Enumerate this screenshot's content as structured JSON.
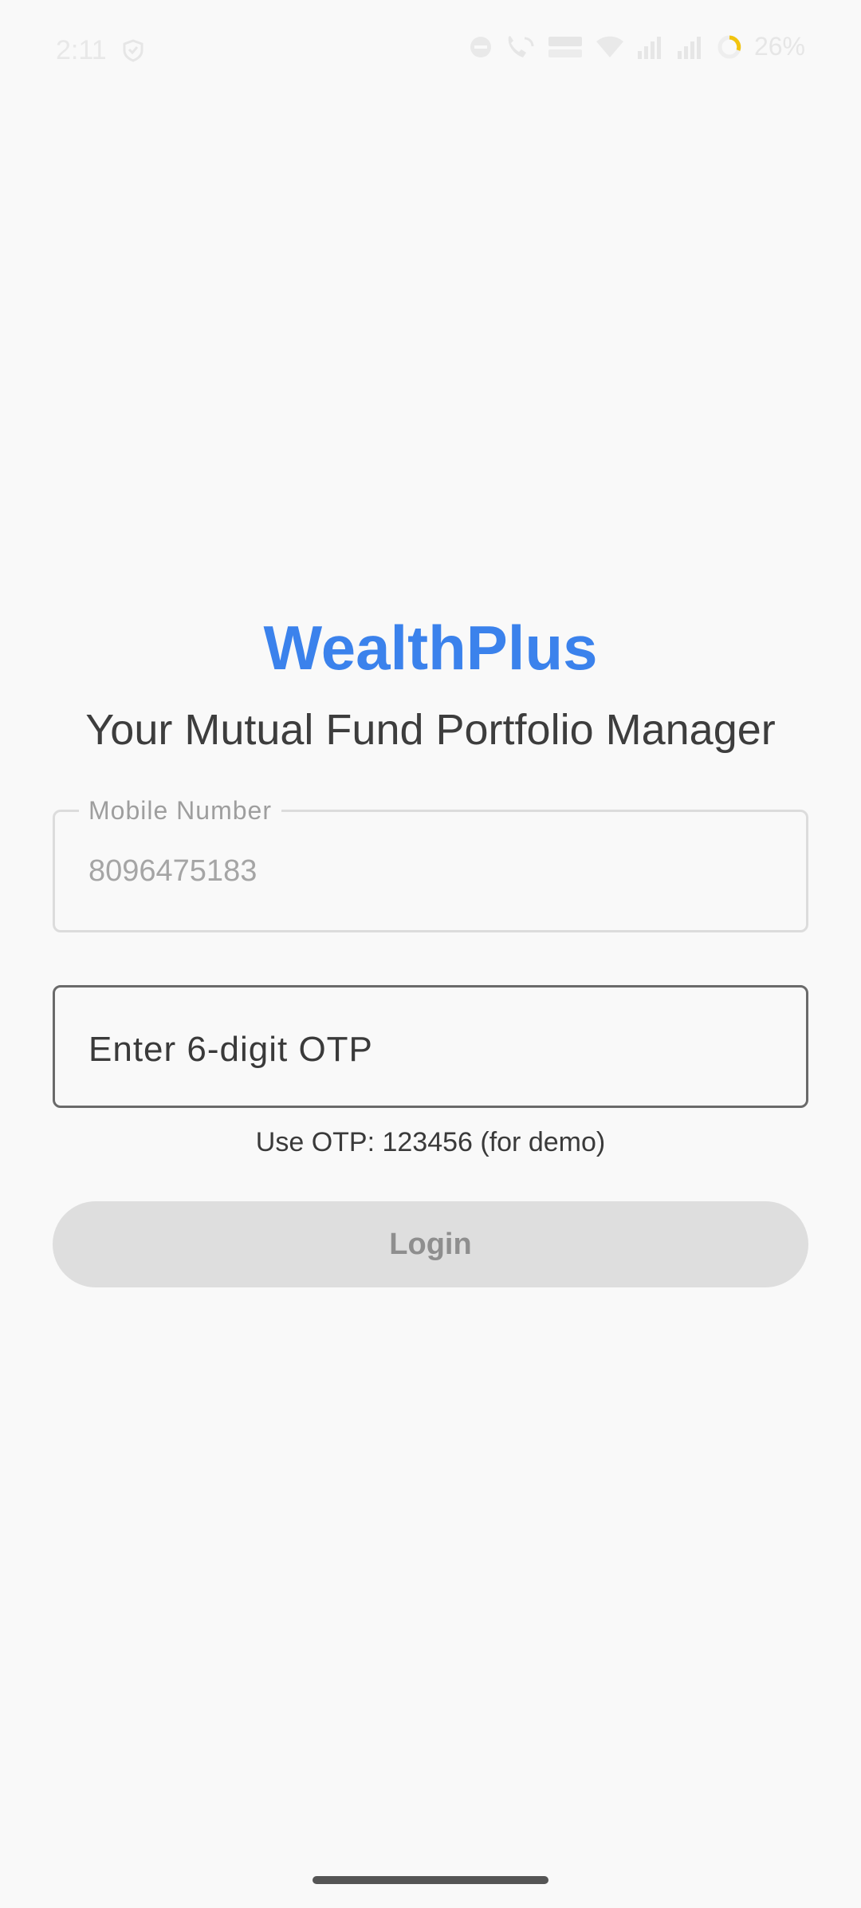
{
  "status_bar": {
    "time": "2:11",
    "battery": "26%"
  },
  "header": {
    "title": "WealthPlus",
    "subtitle": "Your Mutual Fund Portfolio Manager"
  },
  "mobile_field": {
    "label": "Mobile Number",
    "value": "8096475183"
  },
  "otp_field": {
    "placeholder": "Enter 6-digit OTP",
    "value": ""
  },
  "otp_hint": "Use OTP: 123456 (for demo)",
  "login_button": {
    "label": "Login"
  },
  "colors": {
    "brand": "#3b82ec",
    "background": "#f9f9f9",
    "disabled_button": "#dedede"
  }
}
